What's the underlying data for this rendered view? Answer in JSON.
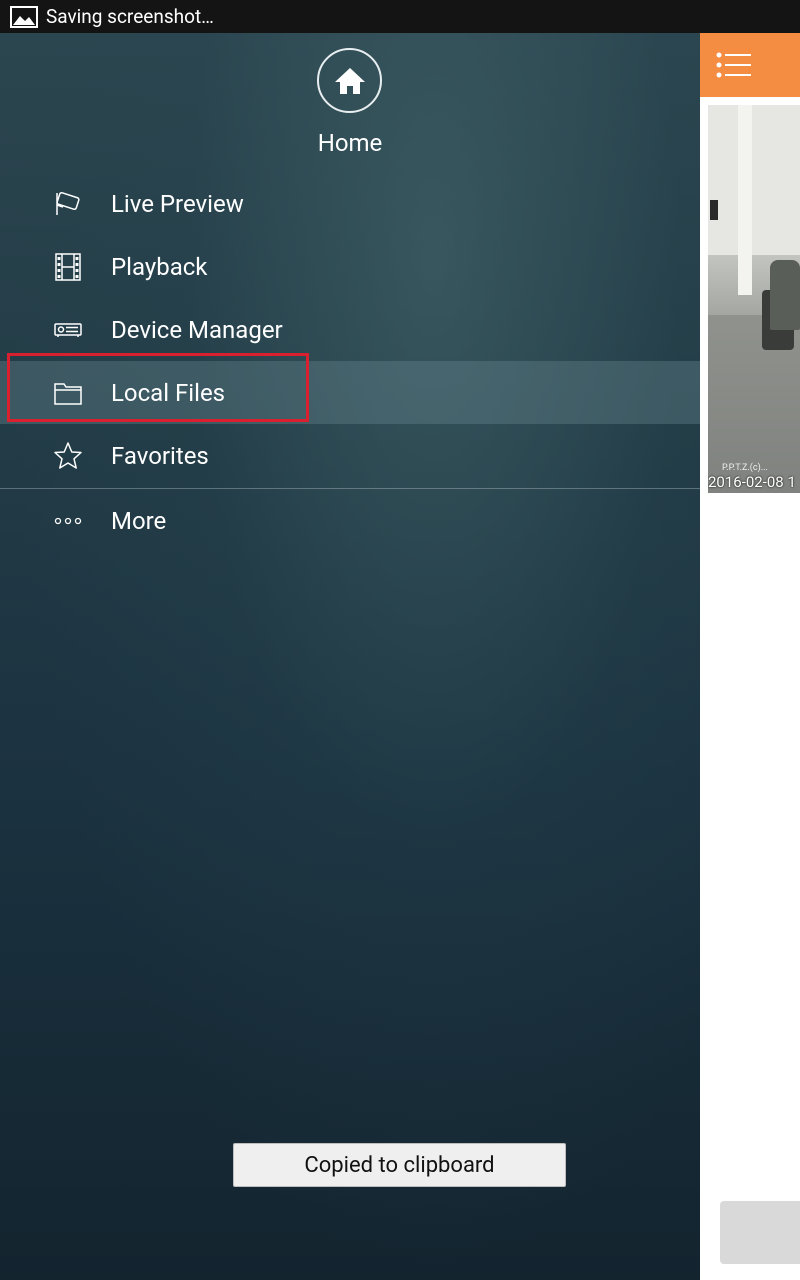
{
  "status_bar": {
    "icon": "image-icon",
    "text": "Saving screenshot…"
  },
  "drawer": {
    "home": {
      "icon": "home-icon",
      "label": "Home"
    },
    "items": [
      {
        "label": "Live Preview",
        "icon": "camera-icon"
      },
      {
        "label": "Playback",
        "icon": "film-icon"
      },
      {
        "label": "Device Manager",
        "icon": "device-icon"
      },
      {
        "label": "Local Files",
        "icon": "folder-icon",
        "selected": true
      },
      {
        "label": "Favorites",
        "icon": "star-icon"
      },
      {
        "label": "More",
        "icon": "more-icon"
      }
    ]
  },
  "main": {
    "menu_icon": "list-menu-icon",
    "camera_timestamp": "2016-02-08 1",
    "camera_label": "P.P.T.Z.(c)..."
  },
  "toast": {
    "text": "Copied to clipboard"
  },
  "colors": {
    "accent": "#f48c42",
    "highlight": "#d9202e"
  }
}
